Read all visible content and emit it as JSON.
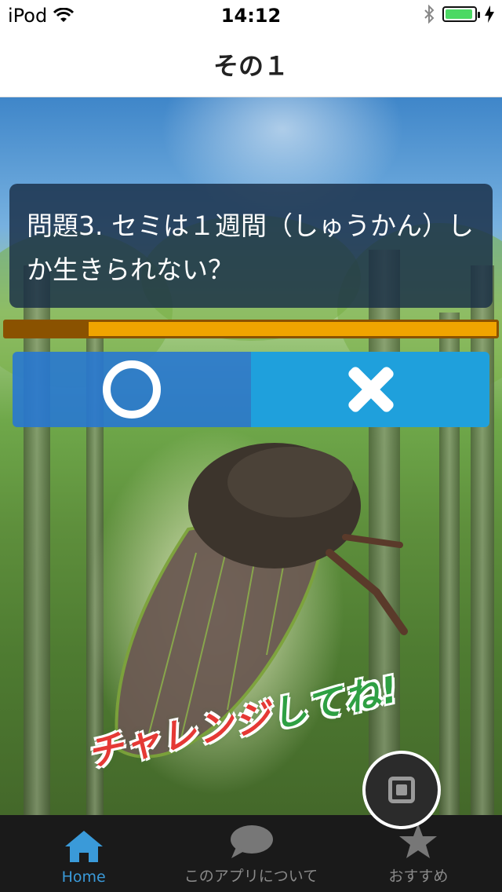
{
  "status_bar": {
    "carrier": "iPod",
    "time": "14:12"
  },
  "nav": {
    "title": "その１"
  },
  "quiz": {
    "question": "問題3. セミは１週間（しゅうかん）しか生きられない？",
    "timer_progress": 0.17,
    "answer_true_icon": "circle-o-icon",
    "answer_false_icon": "cross-x-icon"
  },
  "illustration": {
    "challenge_text_part1": "チャレンジ",
    "challenge_text_part2": "してね!"
  },
  "tabs": [
    {
      "label": "Home",
      "icon": "home-icon",
      "active": true
    },
    {
      "label": "このアプリについて",
      "icon": "speech-bubble-icon",
      "active": false
    },
    {
      "label": "おすすめ",
      "icon": "star-icon",
      "active": false
    }
  ],
  "colors": {
    "tab_active": "#3a9ad9",
    "answer_true_bg": "#2878d2",
    "answer_false_bg": "#1fa0dc",
    "timer_bar": "#f0a400"
  }
}
